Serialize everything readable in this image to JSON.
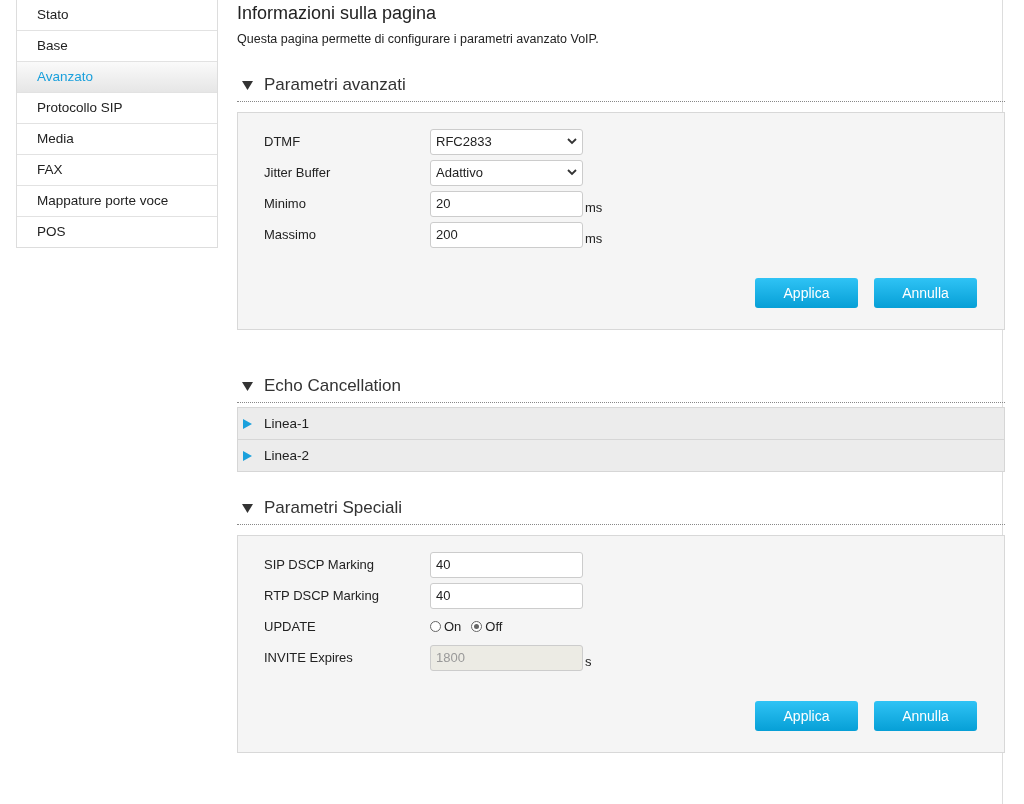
{
  "sidebar": {
    "items": [
      {
        "label": "Stato",
        "selected": false
      },
      {
        "label": "Base",
        "selected": false
      },
      {
        "label": "Avanzato",
        "selected": true
      },
      {
        "label": "Protocollo SIP",
        "selected": false
      },
      {
        "label": "Media",
        "selected": false
      },
      {
        "label": "FAX",
        "selected": false
      },
      {
        "label": "Mappature porte voce",
        "selected": false
      },
      {
        "label": "POS",
        "selected": false
      }
    ]
  },
  "page": {
    "title": "Informazioni sulla pagina",
    "description": "Questa pagina permette di configurare i parametri avanzato VoIP."
  },
  "sections": [
    {
      "kind": "form",
      "title": "Parametri avanzati",
      "expanded": true,
      "fields": [
        {
          "kind": "select",
          "label": "DTMF",
          "value": "RFC2833"
        },
        {
          "kind": "select",
          "label": "Jitter Buffer",
          "value": "Adattivo"
        },
        {
          "kind": "text",
          "label": "Minimo",
          "value": "20",
          "unit": "ms",
          "disabled": false
        },
        {
          "kind": "text",
          "label": "Massimo",
          "value": "200",
          "unit": "ms",
          "disabled": false
        }
      ],
      "buttons": [
        "Applica",
        "Annulla"
      ]
    },
    {
      "kind": "accordion",
      "title": "Echo Cancellation",
      "expanded": true,
      "rows": [
        {
          "label": "Linea-1",
          "expanded": false
        },
        {
          "label": "Linea-2",
          "expanded": false
        }
      ]
    },
    {
      "kind": "form",
      "title": "Parametri Speciali",
      "expanded": true,
      "fields": [
        {
          "kind": "text",
          "label": "SIP DSCP Marking",
          "value": "40",
          "disabled": false
        },
        {
          "kind": "text",
          "label": "RTP DSCP Marking",
          "value": "40",
          "disabled": false
        },
        {
          "kind": "radio",
          "label": "UPDATE",
          "options": [
            {
              "label": "On",
              "selected": false
            },
            {
              "label": "Off",
              "selected": true
            }
          ]
        },
        {
          "kind": "text",
          "label": "INVITE Expires",
          "value": "1800",
          "unit": "s",
          "disabled": true
        }
      ],
      "buttons": [
        "Applica",
        "Annulla"
      ]
    }
  ]
}
